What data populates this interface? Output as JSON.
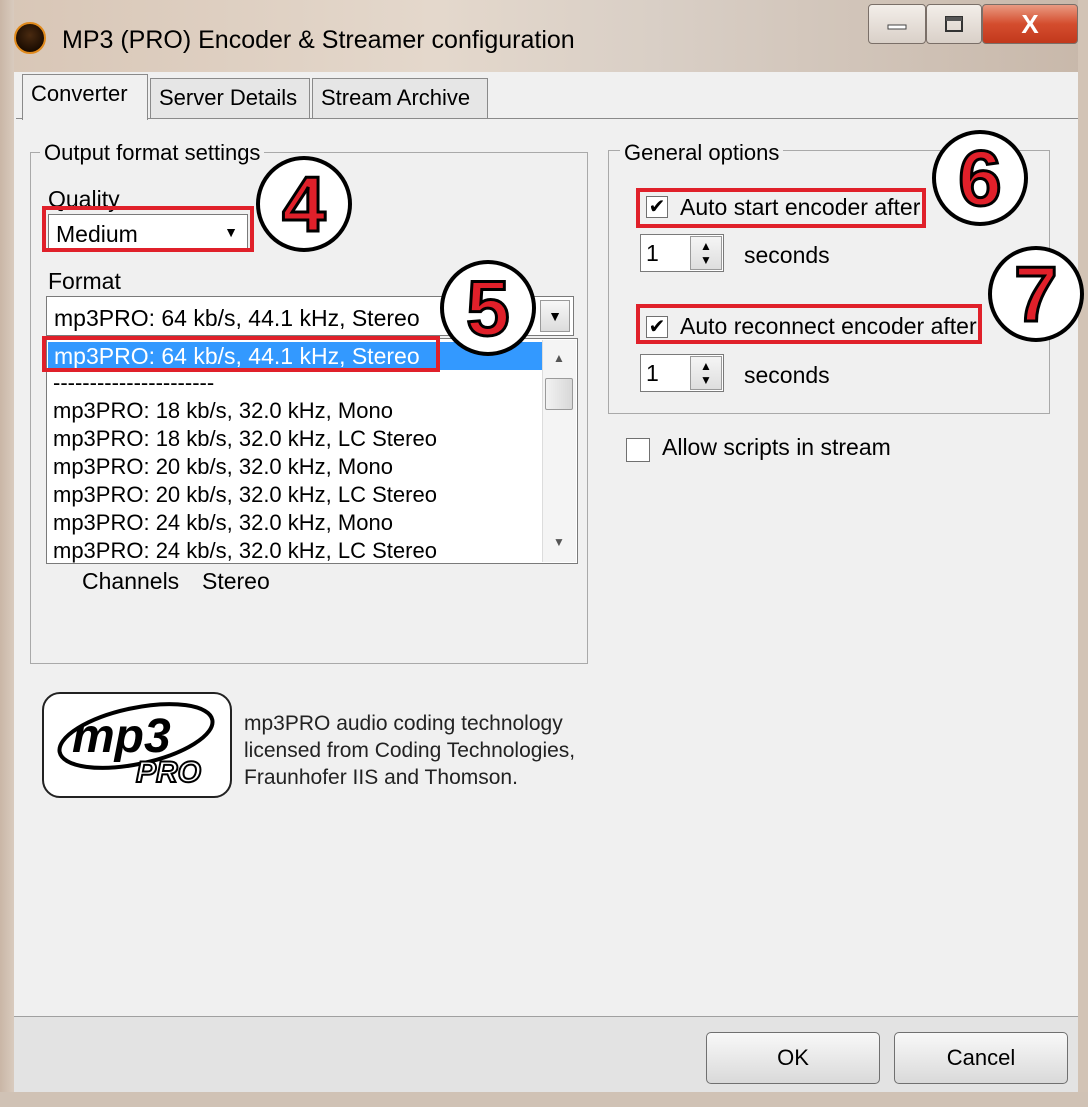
{
  "window": {
    "title": "MP3 (PRO) Encoder & Streamer configuration",
    "close_glyph": "X"
  },
  "tabs": [
    {
      "label": "Converter",
      "active": true
    },
    {
      "label": "Server Details",
      "active": false
    },
    {
      "label": "Stream Archive",
      "active": false
    }
  ],
  "output_format": {
    "group_label": "Output format settings",
    "quality_label": "Quality",
    "quality_value": "Medium",
    "format_label": "Format",
    "format_value": "mp3PRO: 64 kb/s, 44.1 kHz, Stereo",
    "format_options": [
      "mp3PRO: 64 kb/s, 44.1 kHz, Stereo",
      "----------------------",
      "mp3PRO: 18 kb/s, 32.0 kHz, Mono",
      "mp3PRO: 18 kb/s, 32.0 kHz, LC Stereo",
      "mp3PRO: 20 kb/s, 32.0 kHz, Mono",
      "mp3PRO: 20 kb/s, 32.0 kHz, LC Stereo",
      "mp3PRO: 24 kb/s, 32.0 kHz, Mono",
      "mp3PRO: 24 kb/s, 32.0 kHz, LC Stereo"
    ],
    "channels_label": "Channels",
    "channels_value": "Stereo"
  },
  "logo": {
    "line1": "mp3",
    "line2": "PRO"
  },
  "license_text": "mp3PRO audio coding technology licensed from Coding Technologies, Fraunhofer IIS and Thomson.",
  "general_options": {
    "group_label": "General options",
    "auto_start_label": "Auto start encoder after",
    "auto_start_checked": true,
    "auto_start_seconds": "1",
    "seconds_label_1": "seconds",
    "auto_reconnect_label": "Auto reconnect encoder after",
    "auto_reconnect_checked": true,
    "auto_reconnect_seconds": "1",
    "seconds_label_2": "seconds"
  },
  "allow_scripts": {
    "label": "Allow scripts in stream",
    "checked": false
  },
  "buttons": {
    "ok": "OK",
    "cancel": "Cancel"
  },
  "annotations": {
    "badge_4": "4",
    "badge_5": "5",
    "badge_6": "6",
    "badge_7": "7",
    "highlight_color": "#e0202a"
  },
  "check_glyph": "✔"
}
